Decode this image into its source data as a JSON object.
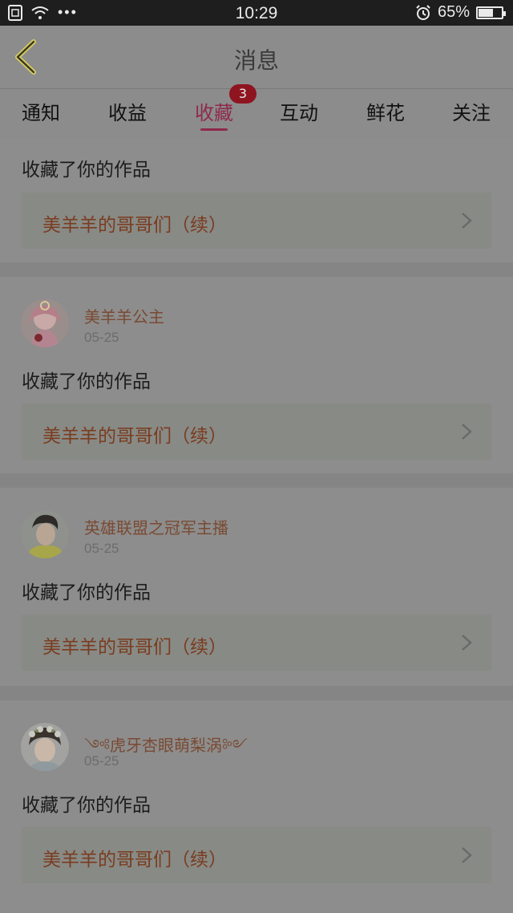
{
  "status_bar": {
    "time": "10:29",
    "battery": "65%",
    "battery_level": 0.65
  },
  "header": {
    "title": "消息",
    "back_icon": "chevron-left-icon"
  },
  "tabs": [
    {
      "label": "通知"
    },
    {
      "label": "收益"
    },
    {
      "label": "收藏",
      "active": true,
      "badge": "3"
    },
    {
      "label": "互动"
    },
    {
      "label": "鲜花"
    },
    {
      "label": "关注"
    }
  ],
  "items": [
    {
      "action": "收藏了你的作品",
      "work_title": "美羊羊的哥哥们（续）"
    },
    {
      "user": "美羊羊公主",
      "date": "05-25",
      "action": "收藏了你的作品",
      "work_title": "美羊羊的哥哥们（续）"
    },
    {
      "user": "英雄联盟之冠军主播",
      "date": "05-25",
      "action": "收藏了你的作品",
      "work_title": "美羊羊的哥哥们（续）"
    },
    {
      "user": "༺虎牙杏眼萌梨涡༻",
      "date": "05-25",
      "action": "收藏了你的作品",
      "work_title": "美羊羊的哥哥们（续）"
    }
  ],
  "colors": {
    "accent": "#8e2a4d",
    "link": "#7a4a33",
    "work_title": "#7a3c20"
  }
}
